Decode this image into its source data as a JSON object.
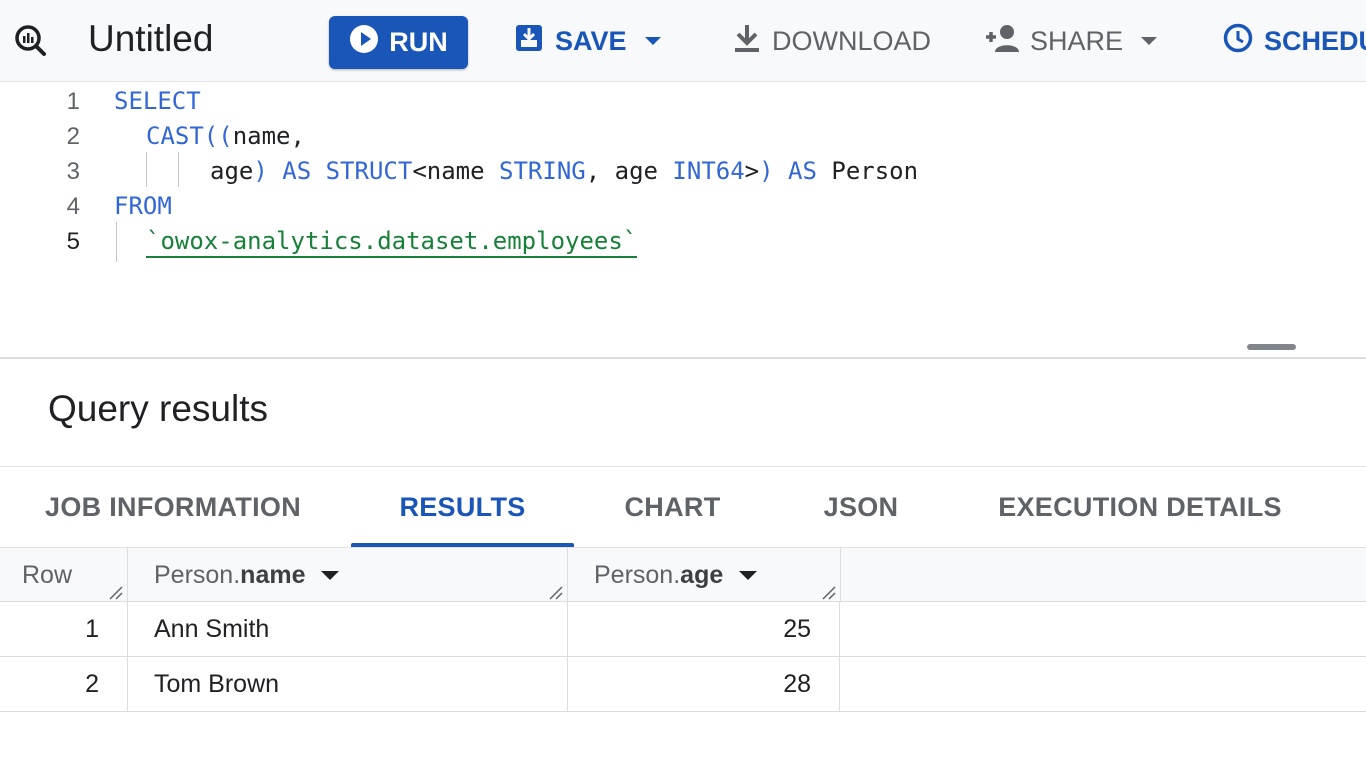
{
  "toolbar": {
    "title": "Untitled",
    "run_label": "RUN",
    "save_label": "SAVE",
    "download_label": "DOWNLOAD",
    "share_label": "SHARE",
    "schedule_label": "SCHEDU",
    "accent_color": "#1a56b7"
  },
  "editor": {
    "lines": [
      {
        "number": "1",
        "tokens": [
          {
            "t": "SELECT",
            "kw": true
          }
        ]
      },
      {
        "number": "2",
        "tokens": [
          {
            "t": "CAST",
            "kw": true
          },
          {
            "t": "((",
            "kw": true
          },
          {
            "t": "name,",
            "kw": false
          }
        ]
      },
      {
        "number": "3",
        "tokens": [
          {
            "t": "age",
            "kw": false
          },
          {
            "t": ") AS STRUCT",
            "kw": true
          },
          {
            "t": "<name ",
            "kw": false
          },
          {
            "t": "STRING",
            "kw": true
          },
          {
            "t": ", age ",
            "kw": false
          },
          {
            "t": "INT64",
            "kw": true
          },
          {
            "t": ">",
            "kw": false
          },
          {
            "t": ") AS ",
            "kw": true
          },
          {
            "t": "Person",
            "kw": false
          }
        ]
      },
      {
        "number": "4",
        "tokens": [
          {
            "t": "FROM",
            "kw": true
          }
        ]
      },
      {
        "number": "5",
        "tokens": [
          {
            "t": "`owox-analytics.dataset.employees`",
            "str": true
          }
        ]
      }
    ]
  },
  "results": {
    "title": "Query results",
    "tabs": [
      "JOB INFORMATION",
      "RESULTS",
      "CHART",
      "JSON",
      "EXECUTION DETAILS"
    ],
    "active_tab": "RESULTS",
    "columns": [
      {
        "label": "Row"
      },
      {
        "prefix": "Person.",
        "field": "name"
      },
      {
        "prefix": "Person.",
        "field": "age"
      }
    ],
    "rows": [
      {
        "row": "1",
        "name": "Ann Smith",
        "age": "25"
      },
      {
        "row": "2",
        "name": "Tom Brown",
        "age": "28"
      }
    ]
  }
}
